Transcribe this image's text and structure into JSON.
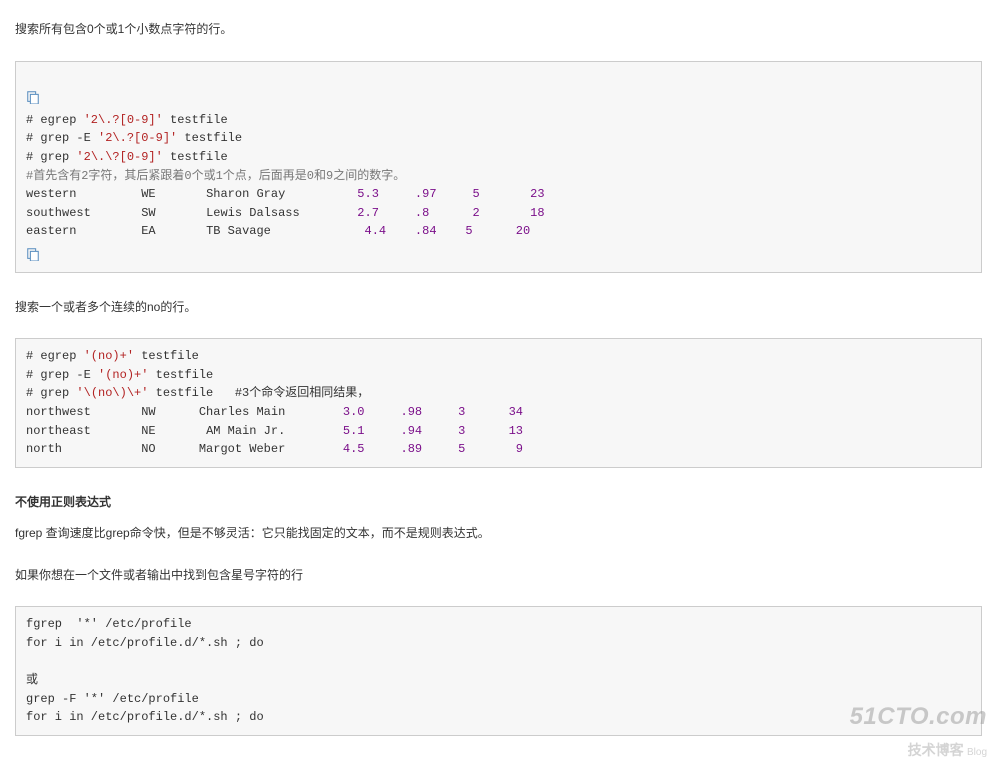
{
  "para1": "搜索所有包含0个或1个小数点字符的行。",
  "code1": {
    "line1_pre": "# egrep ",
    "line1_str": "'2\\.?[0-9]'",
    "line1_post": " testfile",
    "line2_pre": "# grep -E ",
    "line2_str": "'2\\.?[0-9]'",
    "line2_post": " testfile",
    "line3_pre": "# grep ",
    "line3_str": "'2\\.\\?[0-9]'",
    "line3_post": " testfile",
    "line4": "#首先含有2字符，其后紧跟着0个或1个点，后面再是0和9之间的数字。",
    "rows": [
      {
        "r": "western",
        "c": "WE",
        "n": "Sharon Gray",
        "a": "5.3",
        "b": ".97",
        "d": "5",
        "e": "23"
      },
      {
        "r": "southwest",
        "c": "SW",
        "n": "Lewis Dalsass",
        "a": "2.7",
        "b": ".8",
        "d": "2",
        "e": "18"
      },
      {
        "r": "eastern",
        "c": "EA",
        "n": "TB Savage",
        "a": "4.4",
        "b": ".84",
        "d": "5",
        "e": "20"
      }
    ]
  },
  "para2": "搜索一个或者多个连续的no的行。",
  "code2": {
    "line1_pre": "# egrep ",
    "line1_str": "'(no)+'",
    "line1_post": " testfile",
    "line2_pre": "# grep -E ",
    "line2_str": "'(no)+'",
    "line2_post": " testfile",
    "line3_pre": "# grep ",
    "line3_str": "'\\(no\\)\\+'",
    "line3_post": " testfile   #3个命令返回相同结果，",
    "rows": [
      {
        "r": "northwest",
        "c": "NW",
        "n": "Charles Main",
        "a": "3.0",
        "b": ".98",
        "d": "3",
        "e": "34"
      },
      {
        "r": "northeast",
        "c": "NE",
        "n": "AM Main Jr.",
        "a": "5.1",
        "b": ".94",
        "d": "3",
        "e": "13"
      },
      {
        "r": "north",
        "c": "NO",
        "n": "Margot Weber",
        "a": "4.5",
        "b": ".89",
        "d": "5",
        "e": "9"
      }
    ]
  },
  "heading": "不使用正则表达式",
  "para3": "fgrep 查询速度比grep命令快，但是不够灵活：它只能找固定的文本，而不是规则表达式。",
  "para4": "如果你想在一个文件或者输出中找到包含星号字符的行",
  "code3": {
    "line1": "fgrep  '*' /etc/profile",
    "line2": "for i in /etc/profile.d/*.sh ; do",
    "line3": "或",
    "line4": "grep -F '*' /etc/profile",
    "line5": "for i in /etc/profile.d/*.sh ; do"
  },
  "watermark": {
    "top": "51CTO.com",
    "bot": "技术博客",
    "sub": "Blog"
  }
}
